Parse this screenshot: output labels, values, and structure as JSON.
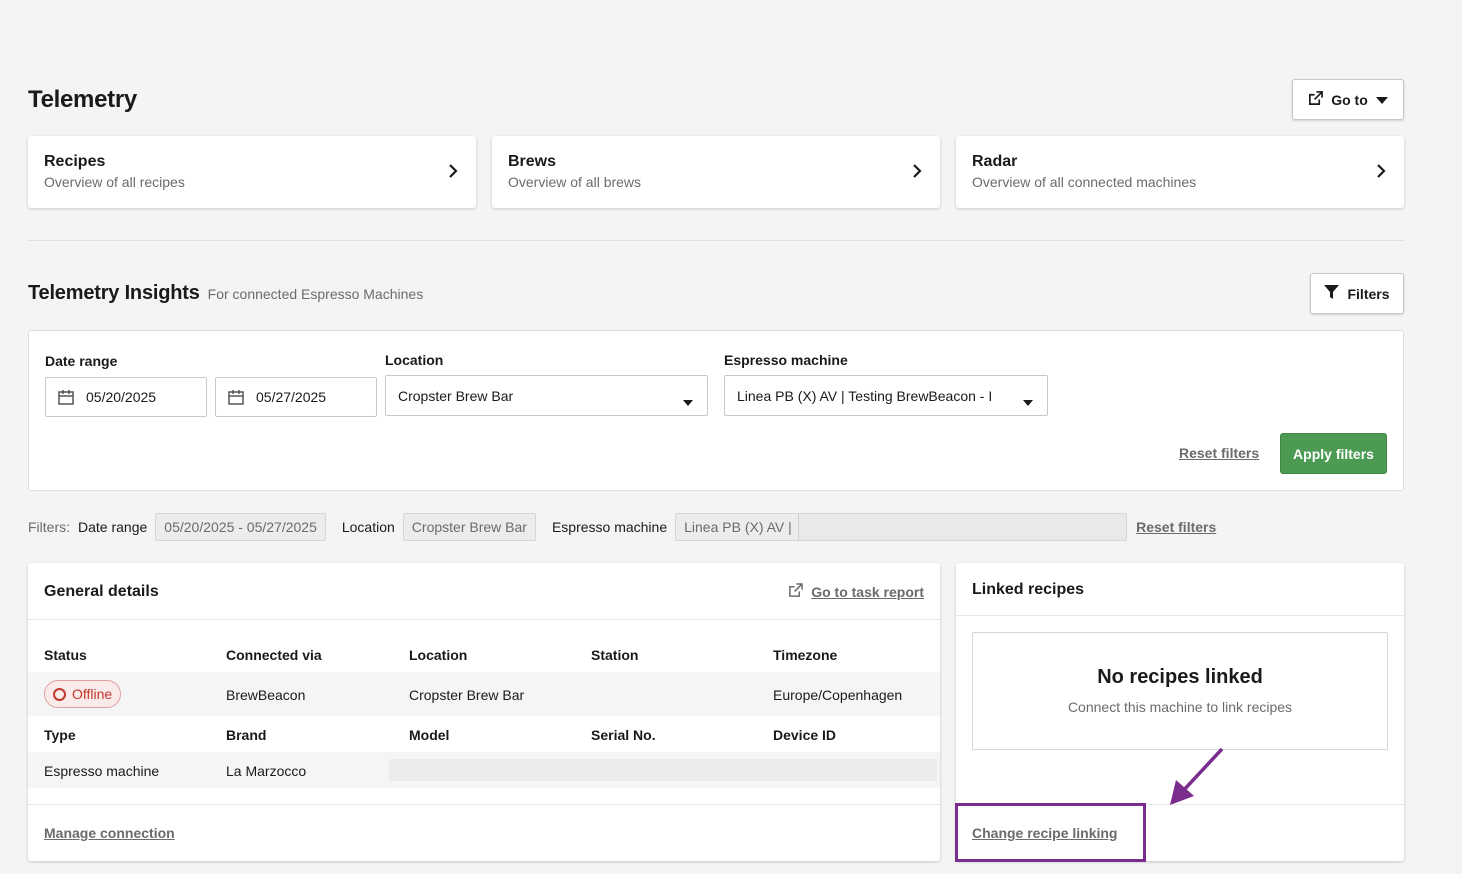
{
  "header": {
    "title": "Telemetry",
    "goto_label": "Go to"
  },
  "nav_cards": [
    {
      "title": "Recipes",
      "subtitle": "Overview of all recipes"
    },
    {
      "title": "Brews",
      "subtitle": "Overview of all brews"
    },
    {
      "title": "Radar",
      "subtitle": "Overview of all connected machines"
    }
  ],
  "insights": {
    "title": "Telemetry Insights",
    "subtitle": "For connected Espresso Machines",
    "filters_label": "Filters"
  },
  "filter_panel": {
    "date_range_label": "Date range",
    "date_from": "05/20/2025",
    "date_to": "05/27/2025",
    "location_label": "Location",
    "location_value": "Cropster Brew Bar",
    "machine_label": "Espresso machine",
    "machine_value": "Linea PB (X) AV | Testing BrewBeacon - I",
    "reset_label": "Reset filters",
    "apply_label": "Apply filters"
  },
  "active_filters": {
    "prefix": "Filters:",
    "date_label": "Date range",
    "date_value": "05/20/2025 - 05/27/2025",
    "location_label": "Location",
    "location_value": "Cropster Brew Bar",
    "machine_label": "Espresso machine",
    "machine_value": "Linea PB (X) AV |",
    "reset_label": "Reset filters"
  },
  "general_details": {
    "title": "General details",
    "task_report_label": "Go to task report",
    "row1_headers": [
      "Status",
      "Connected via",
      "Location",
      "Station",
      "Timezone"
    ],
    "status": "Offline",
    "connected_via": "BrewBeacon",
    "location": "Cropster Brew Bar",
    "station": "",
    "timezone": "Europe/Copenhagen",
    "row2_headers": [
      "Type",
      "Brand",
      "Model",
      "Serial No.",
      "Device ID"
    ],
    "type": "Espresso machine",
    "brand": "La Marzocco",
    "manage_label": "Manage connection"
  },
  "linked_recipes": {
    "title": "Linked recipes",
    "empty_title": "No recipes linked",
    "empty_subtitle": "Connect this machine to link recipes",
    "change_label": "Change recipe linking"
  },
  "colors": {
    "accent_green": "#4d9a53",
    "offline_red": "#c0392b",
    "highlight_purple": "#7b2d8e"
  }
}
